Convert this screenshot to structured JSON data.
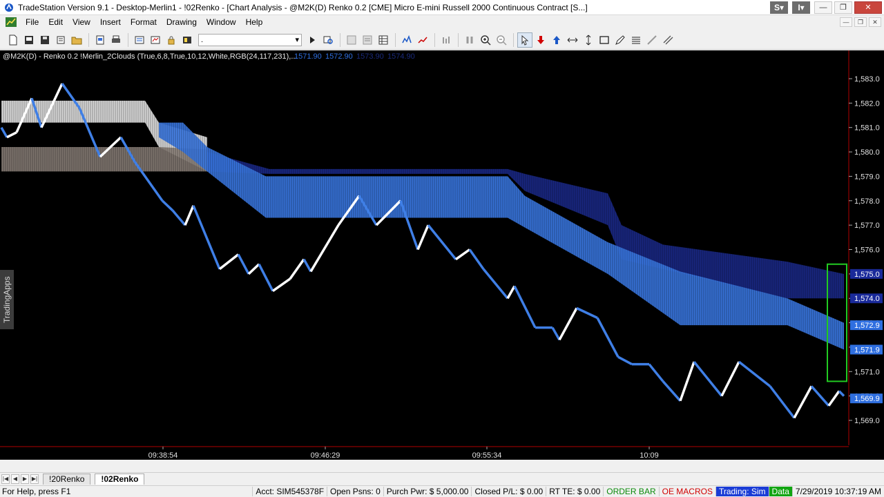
{
  "window": {
    "title": "TradeStation Version 9.1 - Desktop-Merlin1 - !02Renko - [Chart Analysis - @M2K(D) Renko 0.2 [CME] Micro E-mini Russell 2000 Continuous Contract [S...]",
    "badge_s": "S",
    "badge_i": "I"
  },
  "menu": [
    "File",
    "Edit",
    "View",
    "Insert",
    "Format",
    "Drawing",
    "Window",
    "Help"
  ],
  "toolbar": {
    "combo_value": "."
  },
  "chart": {
    "header": "@M2K(D) - Renko 0.2  !Merlin_2Clouds (True,6,8,True,10,12,White,RGB(24,117,231),...",
    "header_values": [
      "1571.90",
      "1572.90",
      "1573.90",
      "1574.90"
    ],
    "header_colors": [
      "#2f6fe0",
      "#2f6fe0",
      "#1a2a7a",
      "#1a2a7a"
    ],
    "side_tab": "TradingApps",
    "y_ticks": [
      "1,583.0",
      "1,582.0",
      "1,581.0",
      "1,580.0",
      "1,579.0",
      "1,578.0",
      "1,577.0",
      "1,576.0",
      "1,575.0",
      "1,574.0",
      "1,573.0",
      "1,572.0",
      "1,571.0",
      "1,570.0",
      "1,569.0"
    ],
    "y_tick_values": [
      1583,
      1582,
      1581,
      1580,
      1579,
      1578,
      1577,
      1576,
      1575,
      1574,
      1573,
      1572,
      1571,
      1570,
      1569
    ],
    "x_ticks": [
      "09:38:54",
      "09:46:29",
      "09:55:34",
      "10:09"
    ],
    "price_markers": [
      {
        "label": "1,575.0",
        "value": 1575.0,
        "color": "#1a2a9a"
      },
      {
        "label": "1,574.0",
        "value": 1574.0,
        "color": "#1a2a9a"
      },
      {
        "label": "1,572.9",
        "value": 1572.9,
        "color": "#2f6fe0"
      },
      {
        "label": "1,571.9",
        "value": 1571.9,
        "color": "#2f6fe0"
      },
      {
        "label": "1,569.9",
        "value": 1569.9,
        "color": "#2f6fe0"
      }
    ],
    "colors": {
      "up": "#ffffff",
      "down": "#3f7fe6",
      "cloud_fast": "#3b7ae6",
      "cloud_slow": "#1b2a8c",
      "cloud_white": "#e8e8e8",
      "cloud_gray": "#8a7f78",
      "highlight": "#22cc22",
      "edge": "#b00000"
    }
  },
  "tabs": [
    "!20Renko",
    "!02Renko"
  ],
  "status": {
    "help": "For Help, press F1",
    "acct": "Acct: SIM545378F",
    "open": "Open Psns: 0",
    "purch": "Purch Pwr: $ 5,000.00",
    "closed": "Closed P/L: $ 0.00",
    "rtte": "RT TE: $ 0.00",
    "orderbar": "ORDER BAR",
    "oemacros": "OE MACROS",
    "trading": "Trading: Sim",
    "data": "Data",
    "datetime": "7/29/2019 10:37:19 AM"
  }
}
